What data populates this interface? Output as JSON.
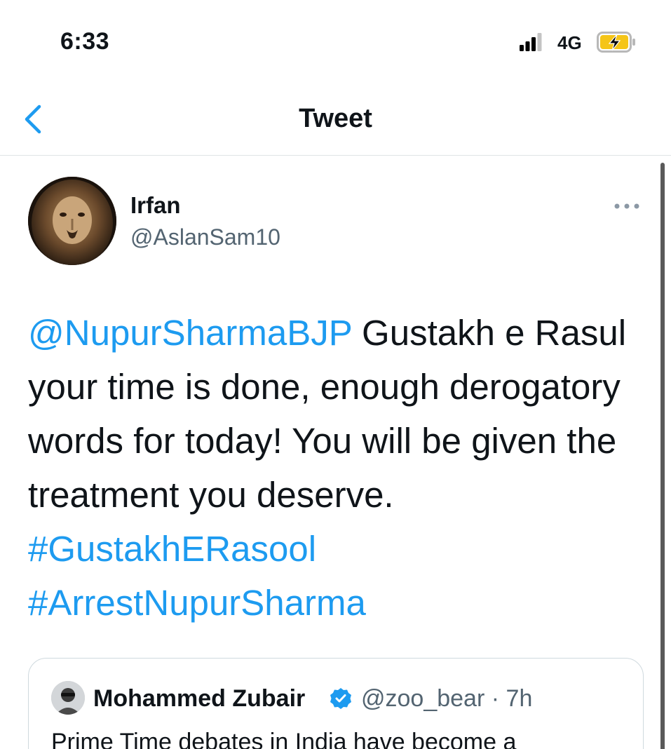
{
  "status_bar": {
    "time": "6:33",
    "network": "4G",
    "icons": [
      "signal-icon",
      "battery-charging-icon"
    ]
  },
  "header": {
    "title": "Tweet",
    "back_icon": "chevron-left-icon"
  },
  "tweet": {
    "author_name": "Irfan",
    "author_handle": "@AslanSam10",
    "mention": "@NupurSharmaBJP",
    "line1_rest": " Gustakh e Rasul",
    "line2": "your time is done, enough derogatory",
    "line3": "words for today! You will be given the",
    "line4": "treatment you deserve.",
    "hashtag1": "#GustakhERasool",
    "hashtag2": "#ArrestNupurSharma",
    "more_icon": "more-dots-icon"
  },
  "quoted_tweet": {
    "author_name": "Mohammed Zubair",
    "author_handle": "@zoo_bear",
    "separator": "·",
    "time": "7h",
    "text": "Prime Time debates in India have become a"
  },
  "colors": {
    "accent": "#1d9bf0",
    "text": "#0f1419",
    "secondary": "#536471",
    "divider": "#dfe3e6"
  }
}
